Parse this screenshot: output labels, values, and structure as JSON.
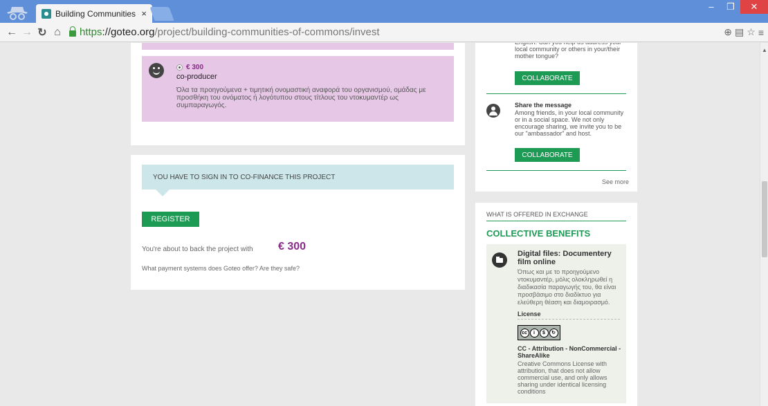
{
  "browser": {
    "tab_title": "Building Communities of",
    "tab_close": "×",
    "url_https": "https",
    "url_host": "://goteo.org",
    "url_path": "/project/building-communities-of-commons/invest"
  },
  "reward": {
    "amount": "€ 300",
    "name": "co-producer",
    "description": "Όλα τα προηγούμενα + τιμητική ονομαστική αναφορά του οργανισμού, ομάδας με προσθήκη του ονόματος ή λογότυπου στους τίτλους του ντοκυμαντέρ ως συμπαραγωγός."
  },
  "signin": {
    "banner": "YOU HAVE TO SIGN IN TO CO-FINANCE THIS PROJECT",
    "register_label": "REGISTER",
    "back_text": "You're about to back the project with",
    "back_amount": "€ 300",
    "payment_question": "What payment systems does Goteo offer? Are they safe?"
  },
  "collaborate": {
    "first_text": "English. Can you help us address your local community or others in your/their mother tongue?",
    "button_label": "COLLABORATE",
    "share_title": "Share the message",
    "share_text": "Among friends, in your local community or in a social space. We not only encourage sharing, we invite you to be our \"ambassador\" and host.",
    "see_more": "See more"
  },
  "exchange": {
    "heading": "WHAT IS OFFERED IN EXCHANGE",
    "collective": "COLLECTIVE BENEFITS",
    "benefit_title": "Digital files: Documentery film online",
    "benefit_desc": "Όπως και με το προηγούμενο ντοκυμαντέρ, μόλις ολοκληρωθεί η διαδικασία παραγωγής του, θα είναι προσβάσιμο στο διαδίκτυο για ελεύθερη θέαση και διαμοιρασμό.",
    "license_label": "License",
    "license_name": "CC - Attribution - NonCommercial - ShareAlike",
    "license_desc": "Creative Commons License with attribution, that does not allow commercial use, and only allows sharing under identical licensing conditions"
  },
  "colors": {
    "green": "#1d9a54",
    "purple": "#8a2a8a",
    "reward_bg": "#e6c8e6",
    "banner_bg": "#cde6e9"
  }
}
